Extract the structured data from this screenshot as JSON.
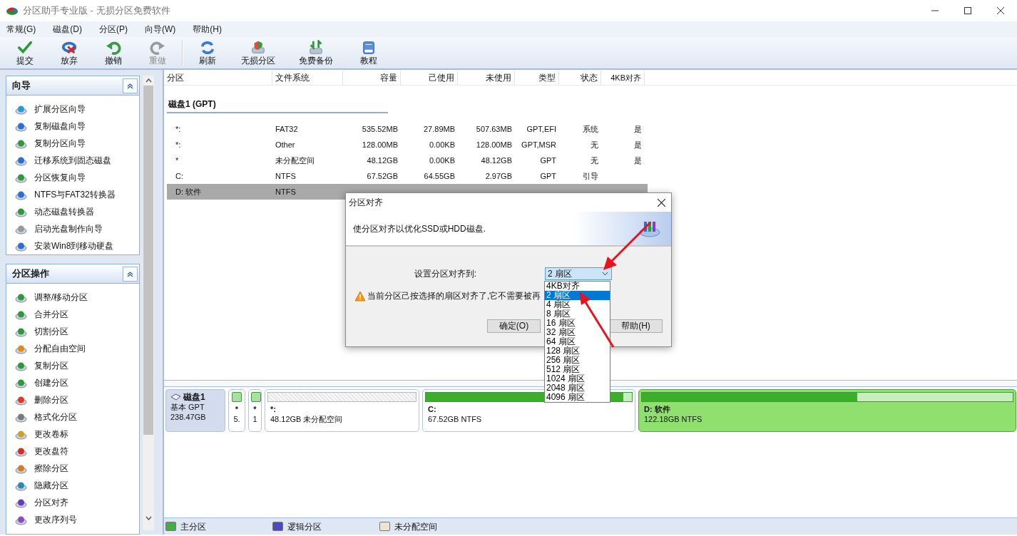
{
  "window": {
    "title": "分区助手专业版 - 无损分区免费软件"
  },
  "menu": [
    "常规(G)",
    "磁盘(D)",
    "分区(P)",
    "向导(W)",
    "帮助(H)"
  ],
  "toolbar": [
    {
      "kind": "commit",
      "label": "提交",
      "disabled": false
    },
    {
      "kind": "discard",
      "label": "放弃",
      "disabled": false
    },
    {
      "kind": "undo",
      "label": "撤销",
      "disabled": false
    },
    {
      "kind": "redo",
      "label": "重做",
      "disabled": true
    },
    {
      "kind": "separator"
    },
    {
      "kind": "refresh",
      "label": "刷新",
      "disabled": false
    },
    {
      "kind": "lossless",
      "label": "无损分区",
      "disabled": false
    },
    {
      "kind": "backup",
      "label": "免费备份",
      "disabled": false
    },
    {
      "kind": "tutorial",
      "label": "教程",
      "disabled": false
    }
  ],
  "sidebar": {
    "panels": [
      {
        "title": "向导",
        "expanded": true,
        "items": [
          "扩展分区向导",
          "复制磁盘向导",
          "复制分区向导",
          "迁移系统到固态磁盘",
          "分区恢复向导",
          "NTFS与FAT32转换器",
          "动态磁盘转换器",
          "启动光盘制作向导",
          "安装Win8到移动硬盘"
        ]
      },
      {
        "title": "分区操作",
        "expanded": true,
        "items": [
          "调整/移动分区",
          "合并分区",
          "切割分区",
          "分配自由空间",
          "复制分区",
          "创建分区",
          "删除分区",
          "格式化分区",
          "更改卷标",
          "更改盘符",
          "擦除分区",
          "隐藏分区",
          "分区对齐",
          "更改序列号"
        ]
      }
    ]
  },
  "table": {
    "columns": [
      "分区",
      "文件系统",
      "容量",
      "己使用",
      "未使用",
      "类型",
      "状态",
      "4KB对齐"
    ],
    "groups": [
      {
        "title": "磁盘1 (GPT)",
        "rows": [
          {
            "name": "*:",
            "fs": "FAT32",
            "capacity": "535.52MB",
            "used": "27.89MB",
            "free": "507.63MB",
            "type": "GPT,EFI",
            "status": "系统",
            "align_4k": "是",
            "selected": false
          },
          {
            "name": "*:",
            "fs": "Other",
            "capacity": "128.00MB",
            "used": "0.00KB",
            "free": "128.00MB",
            "type": "GPT,MSR",
            "status": "无",
            "align_4k": "是",
            "selected": false
          },
          {
            "name": "*",
            "fs": "未分配空间",
            "capacity": "48.12GB",
            "used": "0.00KB",
            "free": "48.12GB",
            "type": "GPT",
            "status": "无",
            "align_4k": "是",
            "selected": false
          },
          {
            "name": "C:",
            "fs": "NTFS",
            "capacity": "67.52GB",
            "used": "64.55GB",
            "free": "2.97GB",
            "type": "GPT",
            "status": "引导",
            "selected": false
          },
          {
            "name": "D: 软件",
            "fs": "NTFS",
            "selected": true
          }
        ]
      }
    ]
  },
  "disk_map": {
    "disk": {
      "name": "磁盘1",
      "type": "基本 GPT",
      "size": "238.47GB"
    },
    "partitions": [
      {
        "kind": "primary",
        "label": "*",
        "detail": "5.",
        "selected": false
      },
      {
        "kind": "primary",
        "label": "*",
        "detail": "1",
        "selected": false
      },
      {
        "kind": "unallocated",
        "label": "*:",
        "detail": "48.12GB 未分配空间",
        "selected": false
      },
      {
        "kind": "primary",
        "label": "C:",
        "detail": "67.52GB NTFS",
        "level": 0.96,
        "selected": false
      },
      {
        "kind": "primary",
        "label": "D: 软件",
        "detail": "122.18GB NTFS",
        "level": 0.58,
        "selected": true
      }
    ]
  },
  "legend": [
    {
      "label": "主分区",
      "color": "#3cb043"
    },
    {
      "label": "逻辑分区",
      "color": "#4a4ac8"
    },
    {
      "label": "未分配空间",
      "color": "#eee4d2"
    }
  ],
  "dialog": {
    "title": "分区对齐",
    "description": "使分区对齐以优化SSD或HDD磁盘.",
    "field_label": "设置分区对齐到:",
    "select": {
      "value": "2 扇区",
      "options": [
        {
          "label": "4KB对齐",
          "selected": false
        },
        {
          "label": "2 扇区",
          "selected": true
        },
        {
          "label": "4 扇区",
          "selected": false
        },
        {
          "label": "8 扇区",
          "selected": false
        },
        {
          "label": "16 扇区",
          "selected": false
        },
        {
          "label": "32 扇区",
          "selected": false
        },
        {
          "label": "64 扇区",
          "selected": false
        },
        {
          "label": "128 扇区",
          "selected": false
        },
        {
          "label": "256 扇区",
          "selected": false
        },
        {
          "label": "512 扇区",
          "selected": false
        },
        {
          "label": "1024 扇区",
          "selected": false
        },
        {
          "label": "2048 扇区",
          "selected": false
        },
        {
          "label": "4096 扇区",
          "selected": false
        }
      ]
    },
    "warning": "当前分区己按选择的扇区对齐了,它不需要被再",
    "buttons": [
      "确定(O)",
      "帮助(H)"
    ]
  }
}
